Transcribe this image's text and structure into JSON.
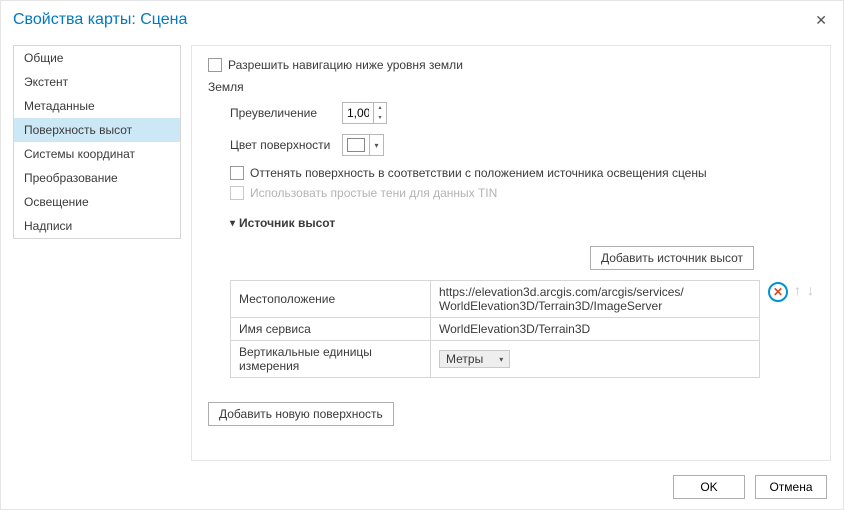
{
  "title": "Свойства карты: Сцена",
  "sidebar": {
    "items": [
      {
        "label": "Общие"
      },
      {
        "label": "Экстент"
      },
      {
        "label": "Метаданные"
      },
      {
        "label": "Поверхность высот"
      },
      {
        "label": "Системы координат"
      },
      {
        "label": "Преобразование"
      },
      {
        "label": "Освещение"
      },
      {
        "label": "Надписи"
      }
    ]
  },
  "page": {
    "allow_below": "Разрешить навигацию ниже уровня земли",
    "ground": "Земля",
    "exagg_label": "Преувеличение",
    "exagg_value": "1,00",
    "surf_color_label": "Цвет поверхности",
    "shade_cb": "Оттенять поверхность в соответствии с положением источника освещения сцены",
    "tin_cb": "Использовать простые тени для данных TIN",
    "elev_src_header": "Источник высот",
    "add_src_btn": "Добавить источник высот",
    "rows": {
      "loc_label": "Местоположение",
      "loc_val1": "https://elevation3d.arcgis.com/arcgis/services/",
      "loc_val2": "WorldElevation3D/Terrain3D/ImageServer",
      "svc_label": "Имя сервиса",
      "svc_val": "WorldElevation3D/Terrain3D",
      "unit_label": "Вертикальные единицы измерения",
      "unit_val": "Метры"
    },
    "add_surface_btn": "Добавить новую поверхность"
  },
  "footer": {
    "ok": "OK",
    "cancel": "Отмена"
  }
}
